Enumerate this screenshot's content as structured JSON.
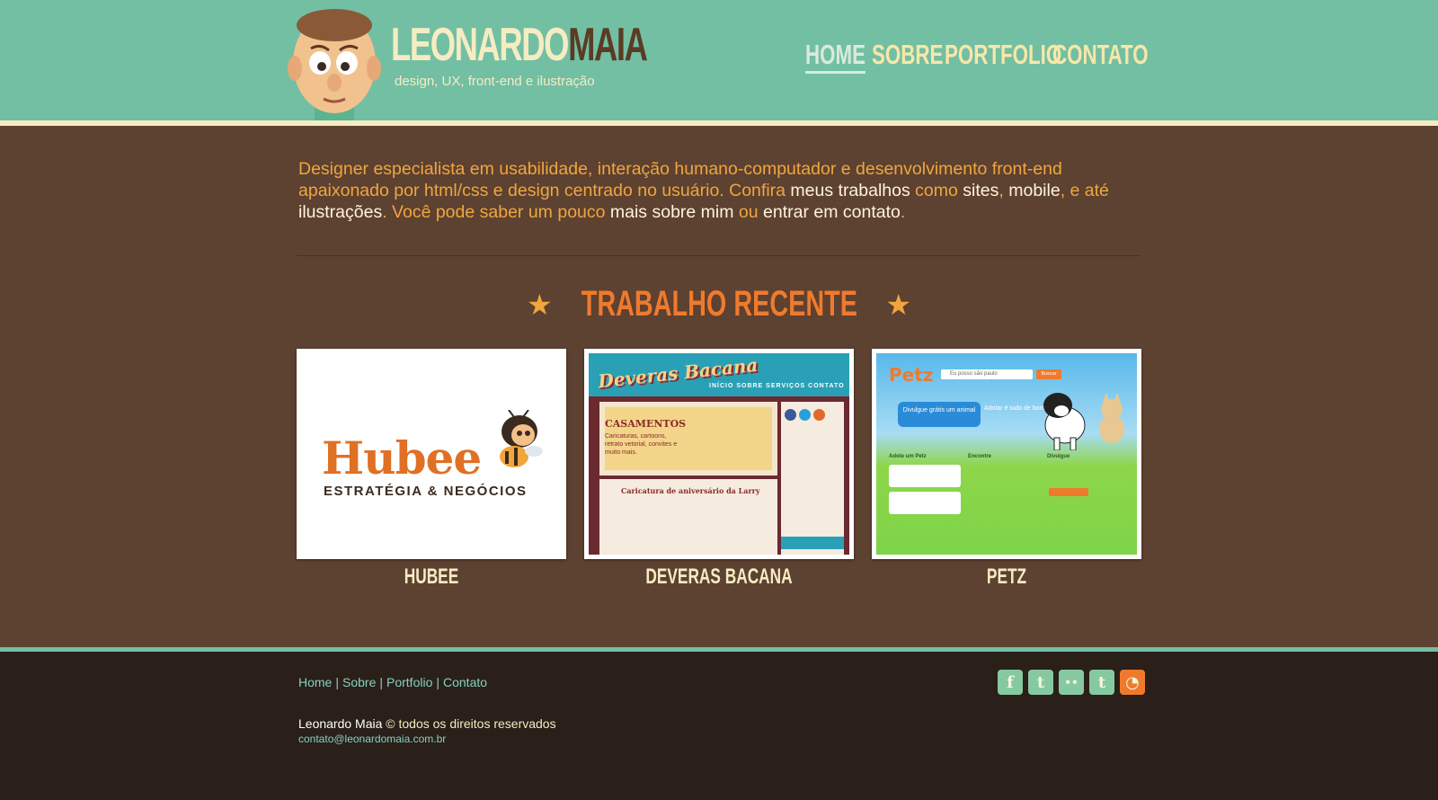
{
  "header": {
    "logo_first": "LEONARDO",
    "logo_last": "MAIA",
    "tagline": "design, UX, front-end e ilustração",
    "nav": [
      {
        "label": "HOME",
        "active": true
      },
      {
        "label": "SOBRE",
        "active": false
      },
      {
        "label": "PORTFOLIO",
        "active": false
      },
      {
        "label": "CONTATO",
        "active": false
      }
    ]
  },
  "intro": {
    "t1": "Designer especialista em usabilidade, interação humano-computador e desenvolvimento front-end apaixonado por html/css e design centrado no usuário. Confira ",
    "l1": "meus trabalhos",
    "t2": " como ",
    "l2": "sites",
    "t3": ", ",
    "l3": "mobile",
    "t4": ", e até ",
    "l4": "ilustrações",
    "t5": ". Você pode saber um pouco ",
    "l5": "mais sobre mim",
    "t6": " ou ",
    "l6": "entrar em contato",
    "t7": "."
  },
  "section": {
    "title": "TRABALHO RECENTE"
  },
  "works": [
    {
      "label": "HUBEE",
      "brand": "Hubee",
      "sub": "ESTRATÉGIA & NEGÓCIOS"
    },
    {
      "label": "DEVERAS BACANA",
      "brand": "Deveras Bacana",
      "nav": "INÍCIO   SOBRE   SERVIÇOS   CONTATO",
      "heading": "CASAMENTOS",
      "sub": "Caricaturas, cartoons, retrato vetorial, convites e muito mais.",
      "article": "Caricatura de aniversário da Larry"
    },
    {
      "label": "PETZ",
      "brand": "Petz",
      "search": "Eu posso são paulo",
      "button": "Buscar",
      "cta": "Divulgue grátis um animal",
      "cta2": "Adotar é tudo de bom!",
      "col1": "Adote um Petz",
      "col2": "Encontre",
      "col3": "Divulgue"
    }
  ],
  "footer": {
    "nav": [
      "Home",
      "Sobre",
      "Portfolio",
      "Contato"
    ],
    "name": "Leonardo Maia",
    "copy": " © todos os direitos reservados",
    "email": "contato@leonardomaia.com.br",
    "social": [
      {
        "icon": "facebook-icon",
        "glyph": "f"
      },
      {
        "icon": "twitter-icon",
        "glyph": "t"
      },
      {
        "icon": "flickr-icon",
        "glyph": "••"
      },
      {
        "icon": "tumblr-icon",
        "glyph": "t"
      },
      {
        "icon": "rss-icon",
        "glyph": "◔"
      }
    ]
  },
  "colors": {
    "header": "#72bfa4",
    "main": "#5d4131",
    "footer": "#2a1f19",
    "accent": "#f07a2c",
    "cream": "#f6ecc2"
  }
}
